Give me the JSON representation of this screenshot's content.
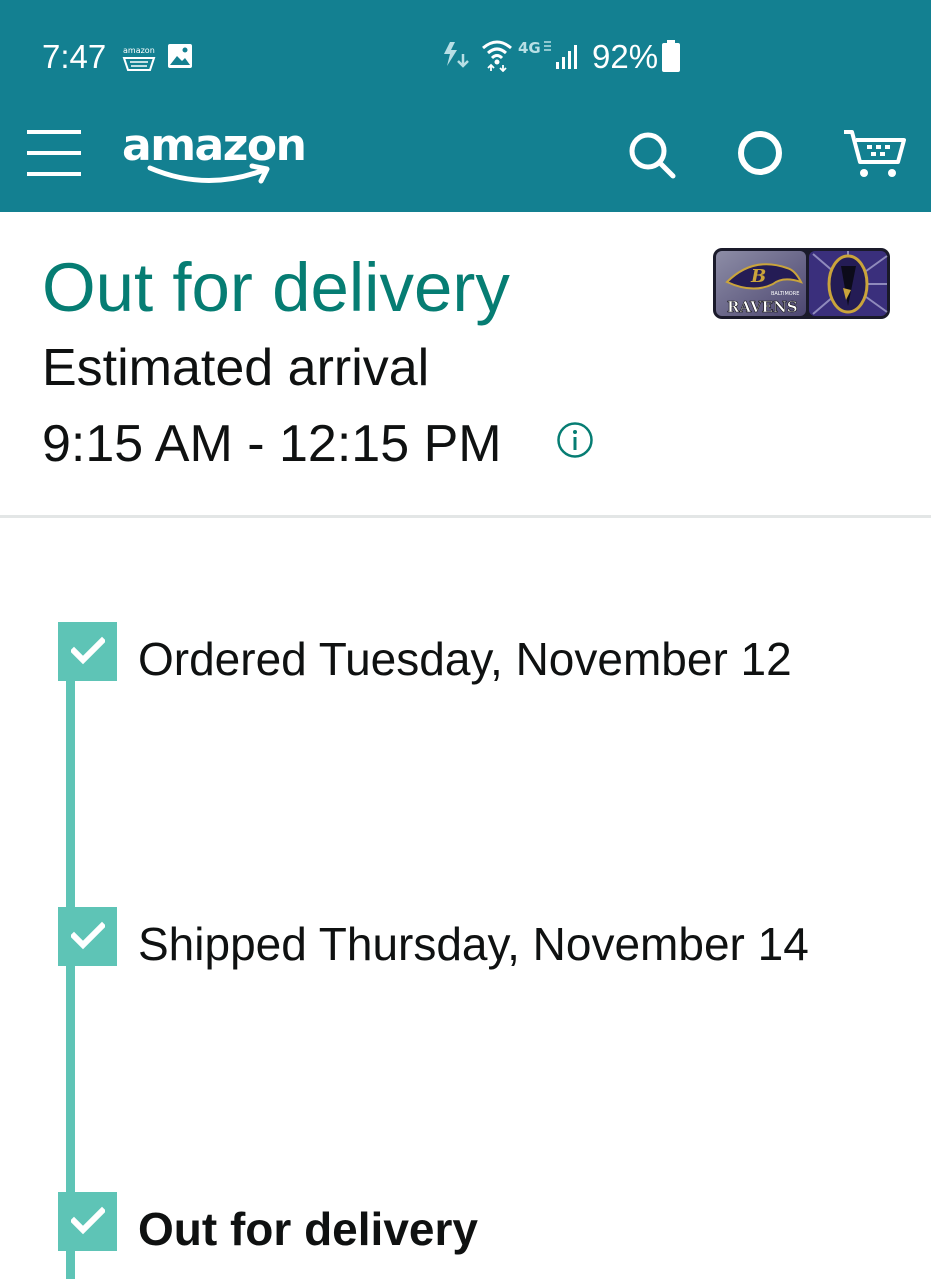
{
  "status_bar": {
    "time": "7:47",
    "battery_percent": "92%",
    "notification_icons": [
      "amazon-app-icon",
      "image-icon"
    ],
    "system_icons": [
      "data-saver-icon",
      "wifi-icon",
      "4g-lte-icon",
      "signal-icon",
      "battery-icon"
    ],
    "amazon_icon_text": "amazon"
  },
  "app_bar": {
    "logo_text": "amazon",
    "icons": [
      "menu-icon",
      "search-icon",
      "alexa-icon",
      "cart-icon"
    ],
    "background_color": "#138091"
  },
  "delivery": {
    "status_title": "Out for delivery",
    "arrival_label": "Estimated arrival",
    "arrival_window": "9:15 AM - 12:15 PM",
    "status_color": "#067d73",
    "product_thumbnail": {
      "brand_text": "RAVENS",
      "subtext": "BALTIMORE"
    }
  },
  "tracker": {
    "accent_color": "#5ec4b6",
    "steps": [
      {
        "label": "Ordered Tuesday, November 12",
        "completed": true,
        "current": false
      },
      {
        "label": "Shipped Thursday, November 14",
        "completed": true,
        "current": false
      },
      {
        "label": "Out for delivery",
        "completed": true,
        "current": true
      }
    ]
  }
}
